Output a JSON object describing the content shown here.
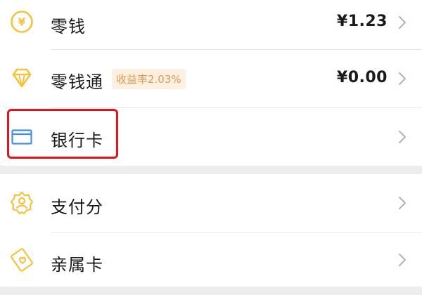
{
  "wallet": {
    "items": [
      {
        "label": "零钱",
        "value": "¥1.23",
        "icon": "yuan-coin-icon",
        "icon_color": "#f5c23a"
      },
      {
        "label": "零钱通",
        "value": "¥0.00",
        "badge": "收益率2.03%",
        "icon": "diamond-icon",
        "icon_color": "#f5c23a"
      },
      {
        "label": "银行卡",
        "icon": "bank-card-icon",
        "icon_color": "#3f8fe6"
      }
    ]
  },
  "services": {
    "items": [
      {
        "label": "支付分",
        "icon": "payscore-badge-icon",
        "icon_color": "#f5c23a"
      },
      {
        "label": "亲属卡",
        "icon": "family-card-icon",
        "icon_color": "#f5c23a"
      }
    ]
  },
  "colors": {
    "accent_yellow": "#f5c23a",
    "card_blue": "#3f8fe6",
    "badge_bg": "#fdf0e0",
    "badge_text": "#d69a52",
    "highlight_red": "#e5141c"
  }
}
